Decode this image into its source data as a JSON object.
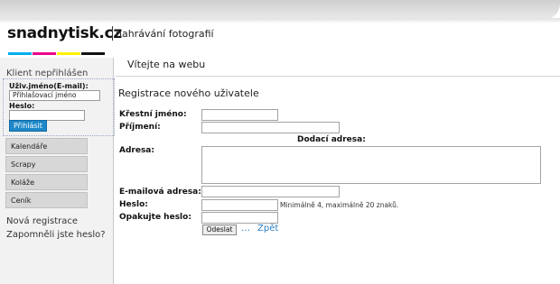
{
  "header": {
    "logo_text": "snadnytisk.cz",
    "subtitle": "nahrávání fotografií",
    "logo_mark_colors": [
      "#00aeef",
      "#ec008c",
      "#fff200",
      "#111111"
    ]
  },
  "sidebar": {
    "status": "Klient nepřihlášen",
    "login": {
      "username_label": "Uživ.jméno(E-mail):",
      "username_value": "Přihlašovací jméno",
      "password_label": "Heslo:",
      "password_value": "",
      "submit_label": "Přihlásit"
    },
    "menu": [
      {
        "label": "Kalendáře"
      },
      {
        "label": "Scrapy"
      },
      {
        "label": "Koláže"
      },
      {
        "label": "Ceník"
      }
    ],
    "links": {
      "register": "Nová registrace",
      "forgot": "Zapomněli jste heslo?"
    }
  },
  "main": {
    "welcome": "Vítejte na webu",
    "form_title": "Registrace nového uživatele",
    "fields": {
      "first_name": "Křestní jméno:",
      "last_name": "Příjmení:",
      "delivery_heading": "Dodací adresa:",
      "address": "Adresa:",
      "email": "E-mailová adresa:",
      "password": "Heslo:",
      "password_repeat": "Opakujte heslo:"
    },
    "password_hint": "Minimálně 4, maximálně 20 znaků.",
    "submit_label": "Odeslat",
    "ellipsis": "…",
    "back_label": "Zpět"
  }
}
